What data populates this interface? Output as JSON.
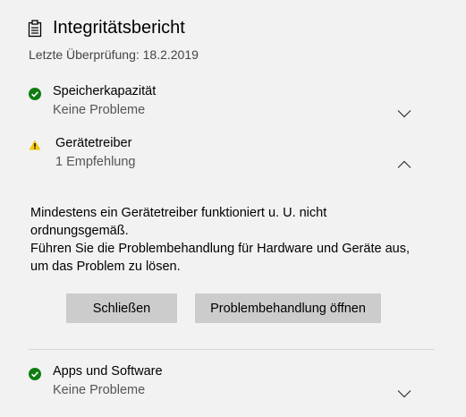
{
  "header": {
    "title": "Integritätsbericht",
    "icon": "clipboard-icon"
  },
  "last_check": "Letzte Überprüfung: 18.2.2019",
  "items": [
    {
      "title": "Speicherkapazität",
      "status": "Keine Probleme",
      "status_icon": "check-circle-icon",
      "status_color": "#107c10",
      "expanded": false
    },
    {
      "title": "Gerätetreiber",
      "status": "1 Empfehlung",
      "status_icon": "warning-icon",
      "status_color": "#f2c80f",
      "expanded": true
    },
    {
      "title": "Apps und Software",
      "status": "Keine Probleme",
      "status_icon": "check-circle-icon",
      "status_color": "#107c10",
      "expanded": false
    }
  ],
  "detail": {
    "line1": "Mindestens ein Gerätetreiber funktioniert u. U. nicht ordnungsgemäß.",
    "line2": "Führen Sie die Problembehandlung für Hardware und Geräte aus, um das Problem zu lösen."
  },
  "buttons": {
    "close_label": "Schließen",
    "troubleshoot_label": "Problembehandlung öffnen"
  },
  "colors": {
    "background": "#f2f2f2",
    "button": "#cccccc",
    "ok": "#107c10",
    "warning": "#f2c80f"
  }
}
